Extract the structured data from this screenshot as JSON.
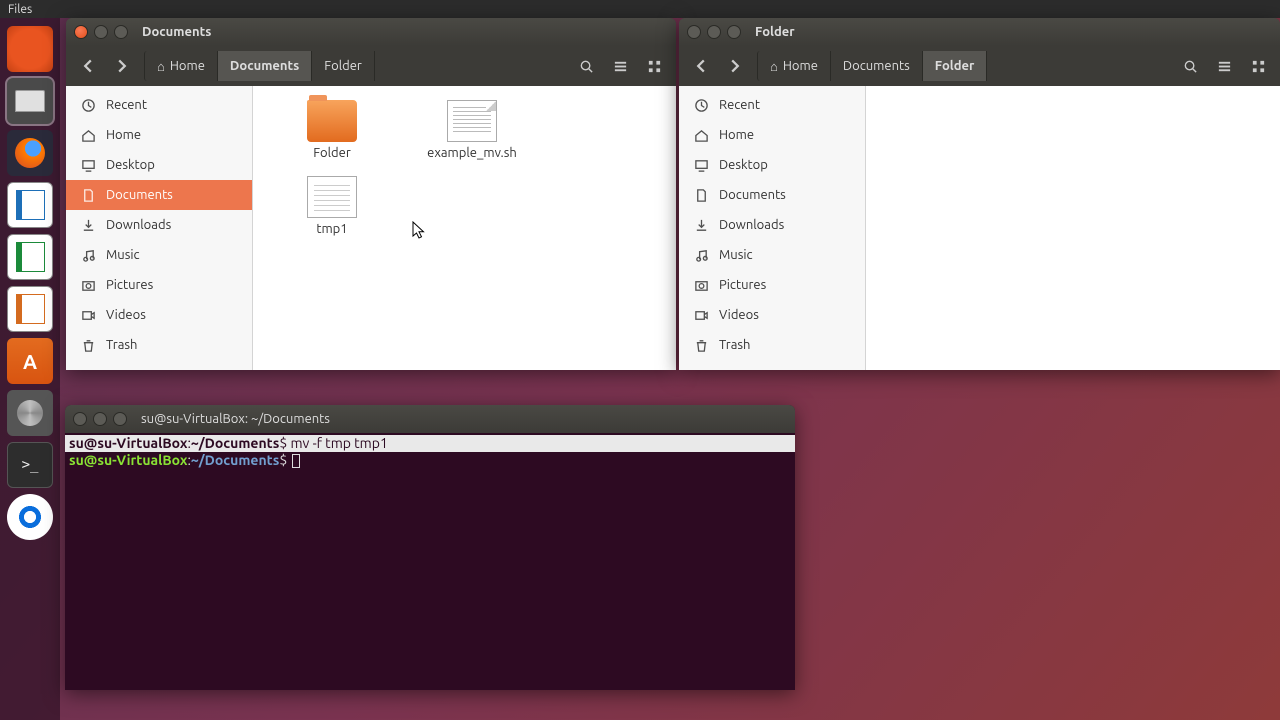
{
  "menubar": {
    "app": "Files"
  },
  "launcher": {
    "items": [
      "ubuntu",
      "files",
      "firefox",
      "writer",
      "calc",
      "impress",
      "software",
      "settings",
      "terminal",
      "teamviewer"
    ]
  },
  "window1": {
    "title": "Documents",
    "path": [
      {
        "label": "Home",
        "icon": "home"
      },
      {
        "label": "Documents",
        "active": true
      },
      {
        "label": "Folder"
      }
    ],
    "sidebar": [
      {
        "label": "Recent",
        "icon": "recent"
      },
      {
        "label": "Home",
        "icon": "home"
      },
      {
        "label": "Desktop",
        "icon": "desktop"
      },
      {
        "label": "Documents",
        "icon": "documents",
        "active": true
      },
      {
        "label": "Downloads",
        "icon": "downloads"
      },
      {
        "label": "Music",
        "icon": "music"
      },
      {
        "label": "Pictures",
        "icon": "pictures"
      },
      {
        "label": "Videos",
        "icon": "videos"
      },
      {
        "label": "Trash",
        "icon": "trash"
      }
    ],
    "files": [
      {
        "name": "Folder",
        "type": "folder"
      },
      {
        "name": "example_mv.sh",
        "type": "script"
      },
      {
        "name": "tmp1",
        "type": "text"
      }
    ]
  },
  "window2": {
    "title": "Folder",
    "path": [
      {
        "label": "Home",
        "icon": "home"
      },
      {
        "label": "Documents"
      },
      {
        "label": "Folder",
        "active": true
      }
    ],
    "sidebar": [
      {
        "label": "Recent",
        "icon": "recent"
      },
      {
        "label": "Home",
        "icon": "home"
      },
      {
        "label": "Desktop",
        "icon": "desktop"
      },
      {
        "label": "Documents",
        "icon": "documents"
      },
      {
        "label": "Downloads",
        "icon": "downloads"
      },
      {
        "label": "Music",
        "icon": "music"
      },
      {
        "label": "Pictures",
        "icon": "pictures"
      },
      {
        "label": "Videos",
        "icon": "videos"
      },
      {
        "label": "Trash",
        "icon": "trash"
      }
    ],
    "files": []
  },
  "terminal": {
    "title": "su@su-VirtualBox: ~/Documents",
    "prompt_user": "su@su-VirtualBox",
    "prompt_path": "~/Documents",
    "lines": [
      {
        "cmd": "mv -f tmp tmp1",
        "highlighted": true
      },
      {
        "cmd": "",
        "cursor": true
      }
    ]
  }
}
